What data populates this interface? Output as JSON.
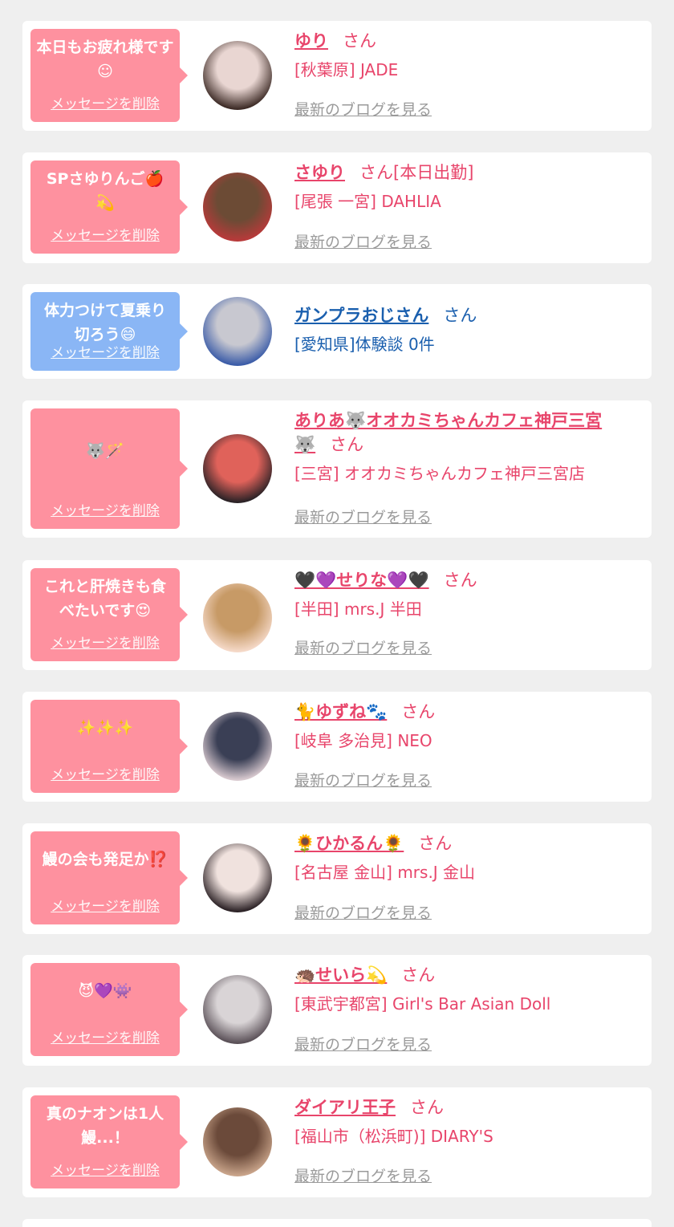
{
  "entries": [
    {
      "message": "本日もお疲れ様です☺",
      "delete_label": "メッセージを削除",
      "name": "ゆり",
      "honorific": "さん",
      "shop": "[秋葉原] JADE",
      "blog_link": "最新のブログを見る",
      "avatar": "avatar-photo-icon",
      "gender": "female",
      "avatar_colors": [
        "#e9d6d2",
        "#3d2b26"
      ]
    },
    {
      "message": "SPさゆりんご🍎\n💫",
      "delete_label": "メッセージを削除",
      "name": "さゆり",
      "honorific": "さん[本日出勤]",
      "shop": "[尾張 一宮] DAHLIA",
      "blog_link": "最新のブログを見る",
      "avatar": "avatar-photo-icon",
      "gender": "female",
      "avatar_colors": [
        "#6c4b35",
        "#b83a3a"
      ]
    },
    {
      "message": "体力つけて夏乗り\n切ろう😄",
      "delete_label": "メッセージを削除",
      "name": "ガンプラおじさん",
      "honorific": "さん",
      "shop": "[愛知県]体験談 0件",
      "blog_link": "",
      "avatar": "avatar-robot-icon",
      "gender": "male",
      "avatar_colors": [
        "#c8c8d0",
        "#3b5ca8"
      ]
    },
    {
      "message": "🐺🪄",
      "delete_label": "メッセージを削除",
      "name": "ありあ🐺オオカミちゃんカフェ神戸三宮\n🐺",
      "honorific": "さん",
      "shop": "[三宮] オオカミちゃんカフェ神戸三宮店",
      "blog_link": "最新のブログを見る",
      "avatar": "avatar-photo-icon",
      "gender": "female",
      "avatar_colors": [
        "#e0625a",
        "#2a2226"
      ]
    },
    {
      "message": "これと肝焼きも食\nべたいです😍",
      "delete_label": "メッセージを削除",
      "name": "🖤💜せりな💜🖤",
      "honorific": "さん",
      "shop": "[半田] mrs.J 半田",
      "blog_link": "最新のブログを見る",
      "avatar": "avatar-photo-icon",
      "gender": "female",
      "avatar_colors": [
        "#c79a66",
        "#f5d9c8"
      ]
    },
    {
      "message": "✨✨✨",
      "delete_label": "メッセージを削除",
      "name": "🐈ゆずね🐾",
      "honorific": "さん",
      "shop": "[岐阜 多治見] NEO",
      "blog_link": "最新のブログを見る",
      "avatar": "avatar-photo-icon",
      "gender": "female",
      "avatar_colors": [
        "#3a3f55",
        "#d8c9cf"
      ]
    },
    {
      "message": "鰻の会も発足か⁉️",
      "delete_label": "メッセージを削除",
      "name": "🌻ひかるん🌻",
      "honorific": "さん",
      "shop": "[名古屋 金山] mrs.J 金山",
      "blog_link": "最新のブログを見る",
      "avatar": "avatar-photo-icon",
      "gender": "female",
      "avatar_colors": [
        "#f0e2de",
        "#2c2226"
      ]
    },
    {
      "message": "😈💜👾",
      "delete_label": "メッセージを削除",
      "name": "🦔せいら💫",
      "honorific": "さん",
      "shop": "[東武宇都宮] Girl's Bar Asian Doll",
      "blog_link": "最新のブログを見る",
      "avatar": "avatar-photo-icon",
      "gender": "female",
      "avatar_colors": [
        "#d9d4d6",
        "#5a5057"
      ]
    },
    {
      "message": "真のナオンは1人\n鰻...！",
      "delete_label": "メッセージを削除",
      "name": "ダイアリ王子",
      "honorific": "さん",
      "shop": "[福山市（松浜町)] DIARY'S",
      "blog_link": "最新のブログを見る",
      "avatar": "avatar-photo-icon",
      "gender": "female",
      "avatar_colors": [
        "#6b4a3a",
        "#c9a48a"
      ]
    }
  ]
}
